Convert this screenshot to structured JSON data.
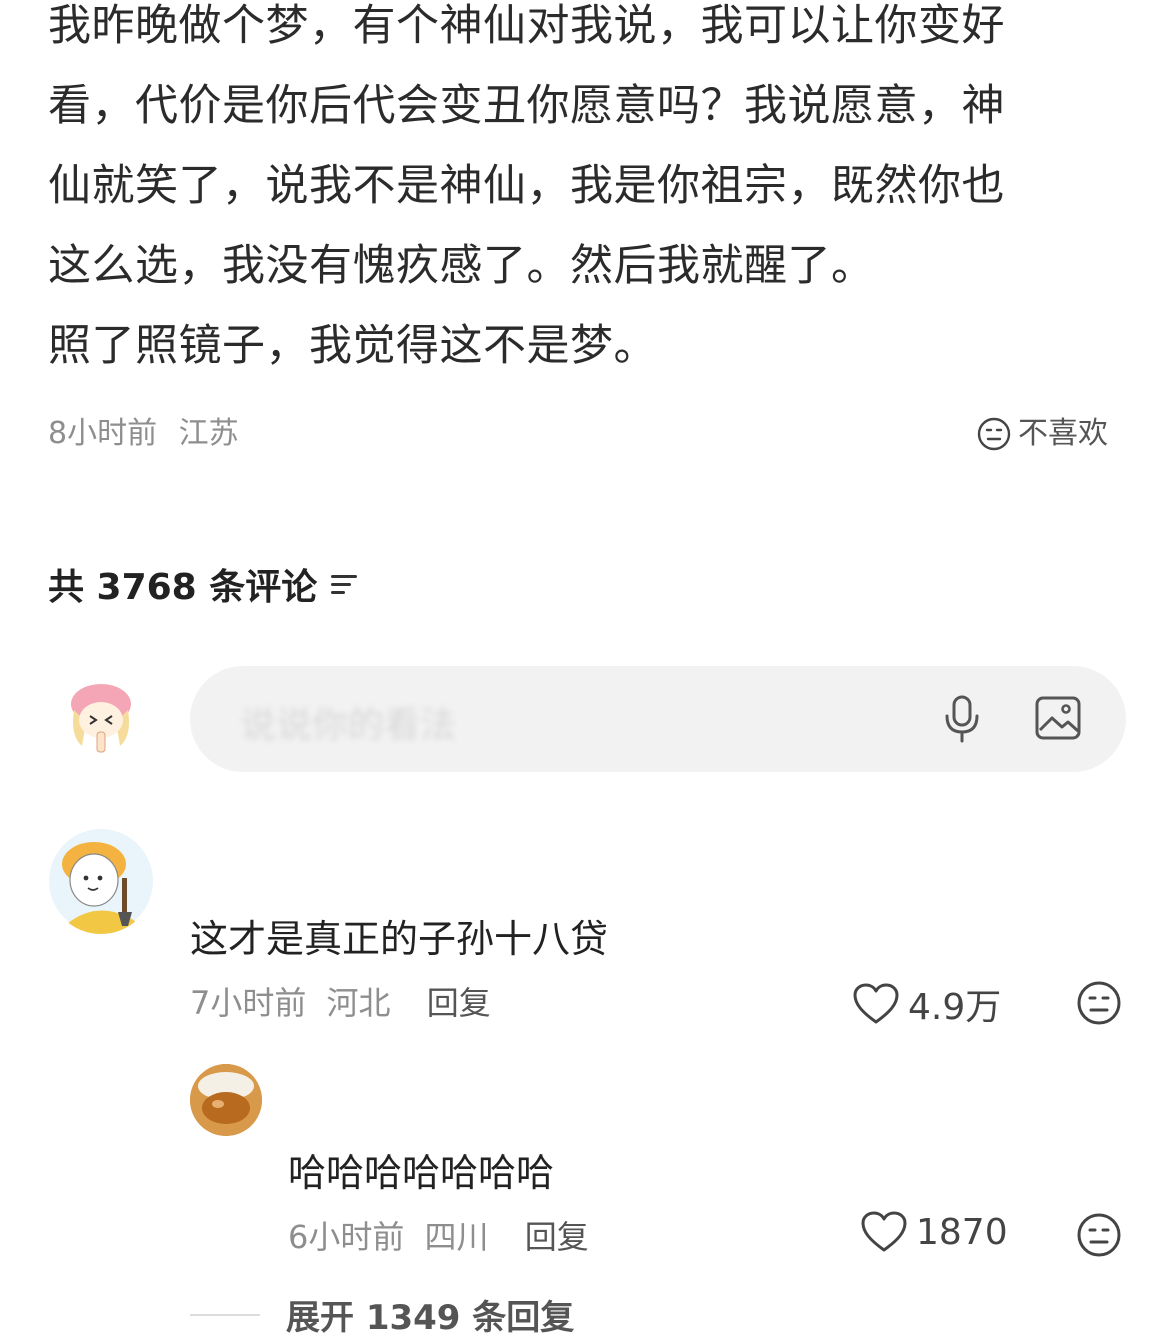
{
  "post": {
    "lines": [
      "我昨晚做个梦，有个神仙对我说，我可以让你变好",
      "看，代价是你后代会变丑你愿意吗？我说愿意，神",
      "仙就笑了，说我不是神仙，我是你祖宗，既然你也",
      "这么选，我没有愧疚感了。然后我就醒了。",
      "照了照镜子，我觉得这不是梦。"
    ],
    "time": "8小时前",
    "location": "江苏",
    "dislike_label": "不喜欢"
  },
  "comments_header": {
    "count_text": "共 3768 条评论"
  },
  "comment_input": {
    "placeholder": "说说你的看法"
  },
  "comments": [
    {
      "text": "这才是真正的子孙十八贷",
      "time": "7小时前",
      "location": "河北",
      "reply_label": "回复",
      "likes": "4.9万"
    },
    {
      "text": "哈哈哈哈哈哈哈",
      "time": "6小时前",
      "location": "四川",
      "reply_label": "回复",
      "likes": "1870"
    }
  ],
  "expand_replies": "展开 1349 条回复",
  "icons": [
    "dislike-face-icon",
    "sort-icon",
    "microphone-icon",
    "image-icon",
    "heart-icon",
    "meh-face-icon"
  ]
}
